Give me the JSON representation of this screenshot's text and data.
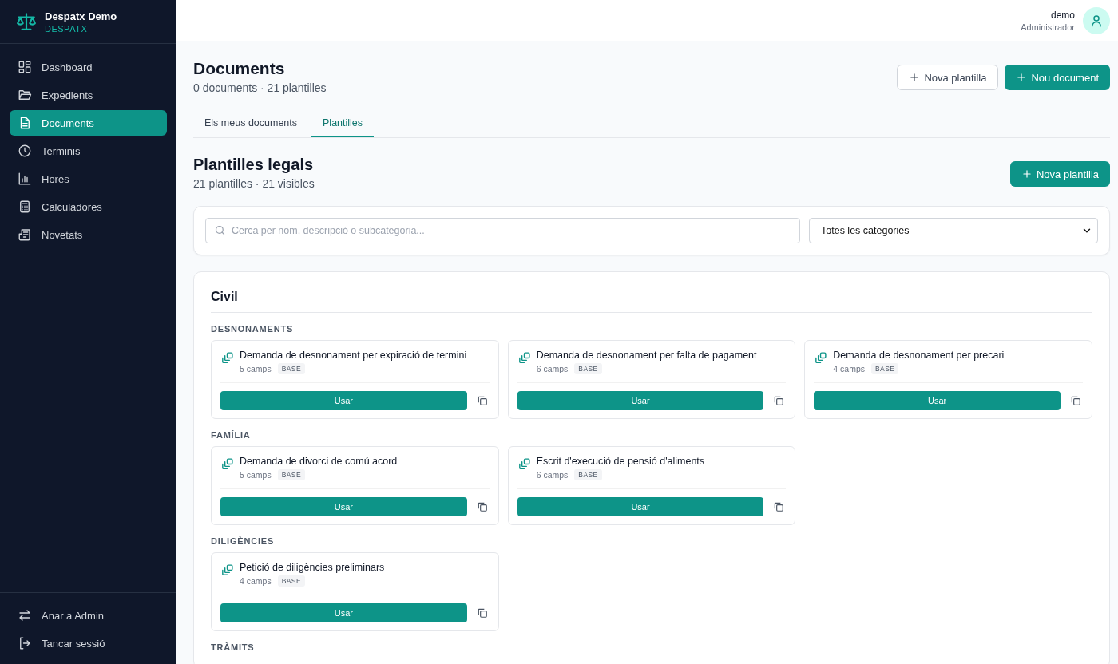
{
  "sidebar": {
    "brand": {
      "name": "Despatx Demo",
      "subtitle": "DESPATX"
    },
    "items": [
      {
        "label": "Dashboard",
        "selected": false
      },
      {
        "label": "Expedients",
        "selected": false
      },
      {
        "label": "Documents",
        "selected": true
      },
      {
        "label": "Terminis",
        "selected": false
      },
      {
        "label": "Hores",
        "selected": false
      },
      {
        "label": "Calculadores",
        "selected": false
      },
      {
        "label": "Novetats",
        "selected": false
      }
    ],
    "footer_items": [
      {
        "label": "Anar a Admin"
      },
      {
        "label": "Tancar sessió"
      }
    ]
  },
  "user": {
    "name": "demo",
    "role": "Administrador"
  },
  "page": {
    "title": "Documents",
    "subtitle": "0 documents · 21 plantilles",
    "buttons": [
      {
        "label": "Nova plantilla",
        "kind": "secondary"
      },
      {
        "label": "Nou document",
        "kind": "primary"
      }
    ]
  },
  "tabs": [
    {
      "label": "Els meus documents",
      "selected": false
    },
    {
      "label": "Plantilles",
      "selected": true
    }
  ],
  "section": {
    "title": "Plantilles legals",
    "subtitle": "21 plantilles · 21 visibles",
    "button": "Nova plantilla"
  },
  "filters": {
    "search_placeholder": "Cerca per nom, descripció o subcategoria...",
    "category": "Totes les categories"
  },
  "category": {
    "title": "Civil",
    "groups": [
      {
        "title": "DESNONAMENTS",
        "templates": [
          {
            "name": "Demanda de desnonament per expiració de termini",
            "fields": "5 camps",
            "badge": "BASE",
            "action": "Usar"
          },
          {
            "name": "Demanda de desnonament per falta de pagament",
            "fields": "6 camps",
            "badge": "BASE",
            "action": "Usar"
          },
          {
            "name": "Demanda de desnonament per precari",
            "fields": "4 camps",
            "badge": "BASE",
            "action": "Usar"
          }
        ]
      },
      {
        "title": "FAMÍLIA",
        "templates": [
          {
            "name": "Demanda de divorci de comú acord",
            "fields": "5 camps",
            "badge": "BASE",
            "action": "Usar"
          },
          {
            "name": "Escrit d'execució de pensió d'aliments",
            "fields": "6 camps",
            "badge": "BASE",
            "action": "Usar"
          }
        ]
      },
      {
        "title": "DILIGÈNCIES",
        "templates": [
          {
            "name": "Petició de diligències preliminars",
            "fields": "4 camps",
            "badge": "BASE",
            "action": "Usar"
          }
        ]
      },
      {
        "title": "TRÀMITS"
      }
    ]
  }
}
